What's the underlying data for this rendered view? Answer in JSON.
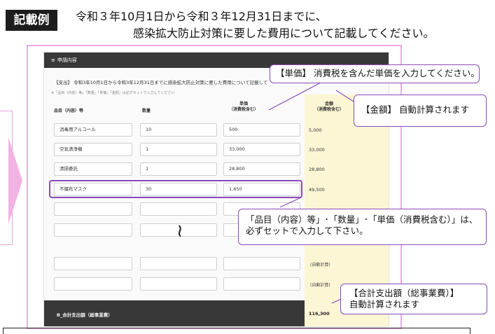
{
  "header": {
    "badge": "記載例",
    "line1": "令和３年10月1日から令和３年12月31日までに、",
    "line2": "感染拡大防止対策に要した費用について記載してください。"
  },
  "form": {
    "panel_title": "申請内容",
    "note": "【支出】 令和3年10月1日から令和3年12月31日までに感染拡大防止対策に要した費用について記載して",
    "sub_note": "※「品目（内容）等」「数量」「単価」「金額」は必ずセットで入力してください",
    "columns": {
      "item": "品目（内容）等",
      "qty": "数量",
      "unit_price": "単価\n（消費税含む）",
      "amount": "金額\n（消費税含む）"
    },
    "rows": [
      {
        "item": "消毒用アルコール",
        "qty": "10",
        "unit_price": "500",
        "amount": "5,000"
      },
      {
        "item": "空気清浄機",
        "qty": "1",
        "unit_price": "33,000",
        "amount": "33,000"
      },
      {
        "item": "清掃委託",
        "qty": "1",
        "unit_price": "28,800",
        "amount": "28,800"
      },
      {
        "item": "不織布マスク",
        "qty": "30",
        "unit_price": "1,650",
        "amount": "49,500"
      }
    ],
    "auto_calc_label": "(自動計算)",
    "total_label": "B_合計支出額（総事業費）",
    "total_value": "116,300"
  },
  "callouts": {
    "unit_price": "【単価】 消費税を含んだ単価を入力してください。",
    "amount": "【金額】 自動計算されます",
    "set_line1": "「品目（内容）等」･「数量」･「単価（消費税含む）」は、",
    "set_line2": "必ずセットで入力して下さい。",
    "total_line1": "【合計支出額（総事業費）】",
    "total_line2": "自動計算されます"
  },
  "icons": {
    "panel_header": "list-icon",
    "omission": "wave-omission-icon",
    "arrow": "right-arrow-icon"
  },
  "colors": {
    "frame_pink": "#f2a8e3",
    "callout_purple": "#8a4bb7",
    "amount_fill": "#fcf6d4",
    "header_dark": "#383838"
  }
}
